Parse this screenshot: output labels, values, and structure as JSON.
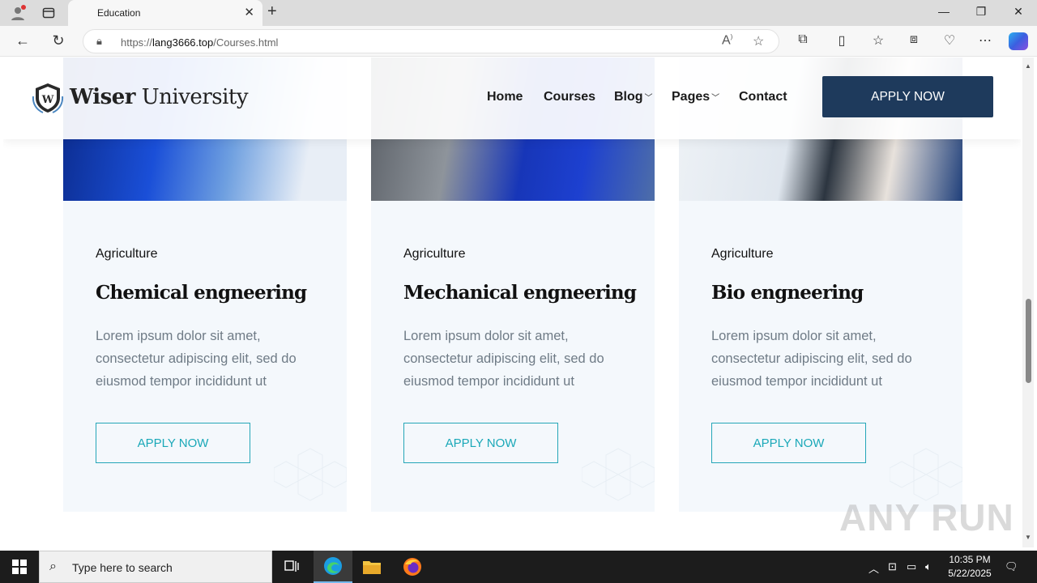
{
  "browser": {
    "tab_title": "Education",
    "url_prefix": "https://",
    "url_domain": "lang3666.top",
    "url_path": "/Courses.html"
  },
  "site": {
    "logo_bold": "Wiser",
    "logo_rest": " University",
    "nav": [
      "Home",
      "Courses",
      "Blog",
      "Pages",
      "Contact"
    ],
    "apply_label": "APPLY NOW"
  },
  "courses": [
    {
      "category": "Agriculture",
      "title": "Chemical engneering",
      "description": "Lorem ipsum dolor sit amet, consectetur adipiscing elit, sed do eiusmod tempor incididunt ut",
      "button": "APPLY NOW"
    },
    {
      "category": "Agriculture",
      "title": "Mechanical engneering",
      "description": "Lorem ipsum dolor sit amet, consectetur adipiscing elit, sed do eiusmod tempor incididunt ut",
      "button": "APPLY NOW"
    },
    {
      "category": "Agriculture",
      "title": "Bio engneering",
      "description": "Lorem ipsum dolor sit amet, consectetur adipiscing elit, sed do eiusmod tempor incididunt ut",
      "button": "APPLY NOW"
    }
  ],
  "watermark": "ANY RUN",
  "taskbar": {
    "search_placeholder": "Type here to search",
    "time": "10:35 PM",
    "date": "5/22/2025"
  },
  "colors": {
    "brand_navy": "#1e3a5c",
    "accent_teal": "#1aa8b8",
    "card_bg": "#f4f8fc"
  }
}
